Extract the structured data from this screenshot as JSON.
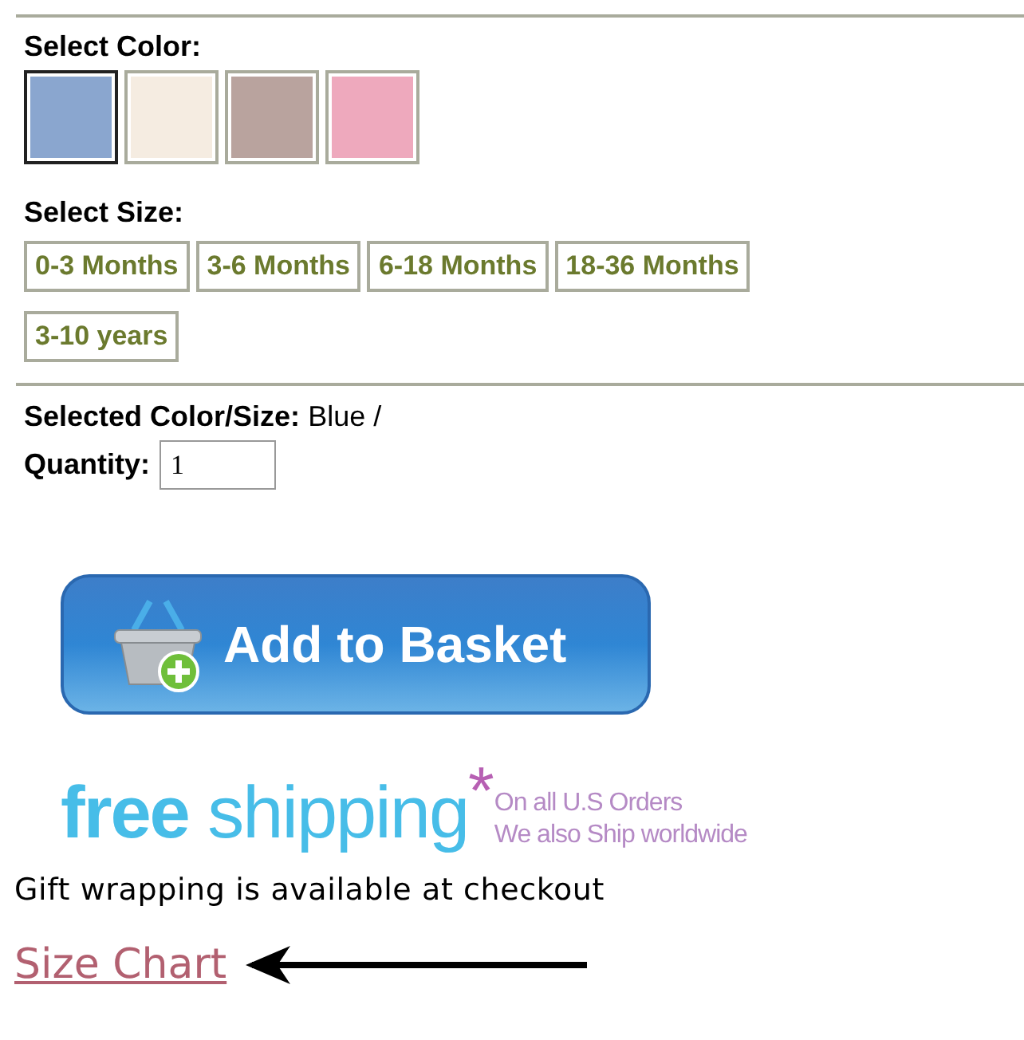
{
  "color_section": {
    "label": "Select Color:",
    "swatches": [
      {
        "color": "#8aa6cf",
        "selected": true
      },
      {
        "color": "#f5ece1",
        "selected": false
      },
      {
        "color": "#b9a39e",
        "selected": false
      },
      {
        "color": "#eea9bd",
        "selected": false
      }
    ]
  },
  "size_section": {
    "label": "Select Size:",
    "sizes": [
      {
        "label": "0-3 Months",
        "selected": false
      },
      {
        "label": "3-6 Months",
        "selected": false
      },
      {
        "label": "6-18 Months",
        "selected": false
      },
      {
        "label": "18-36 Months",
        "selected": false
      },
      {
        "label": "3-10 years",
        "selected": false
      }
    ]
  },
  "selection": {
    "label": "Selected Color/Size:",
    "value": "Blue /"
  },
  "quantity": {
    "label": "Quantity:",
    "value": "1"
  },
  "add_button": {
    "label": "Add to Basket"
  },
  "shipping_banner": {
    "headline": "**free** shipping",
    "mark": "*",
    "lines": [
      "On all U.S Orders",
      "We also Ship worldwide"
    ]
  },
  "gift_note": "Gift wrapping is available at checkout",
  "size_chart_link": "Size Chart"
}
